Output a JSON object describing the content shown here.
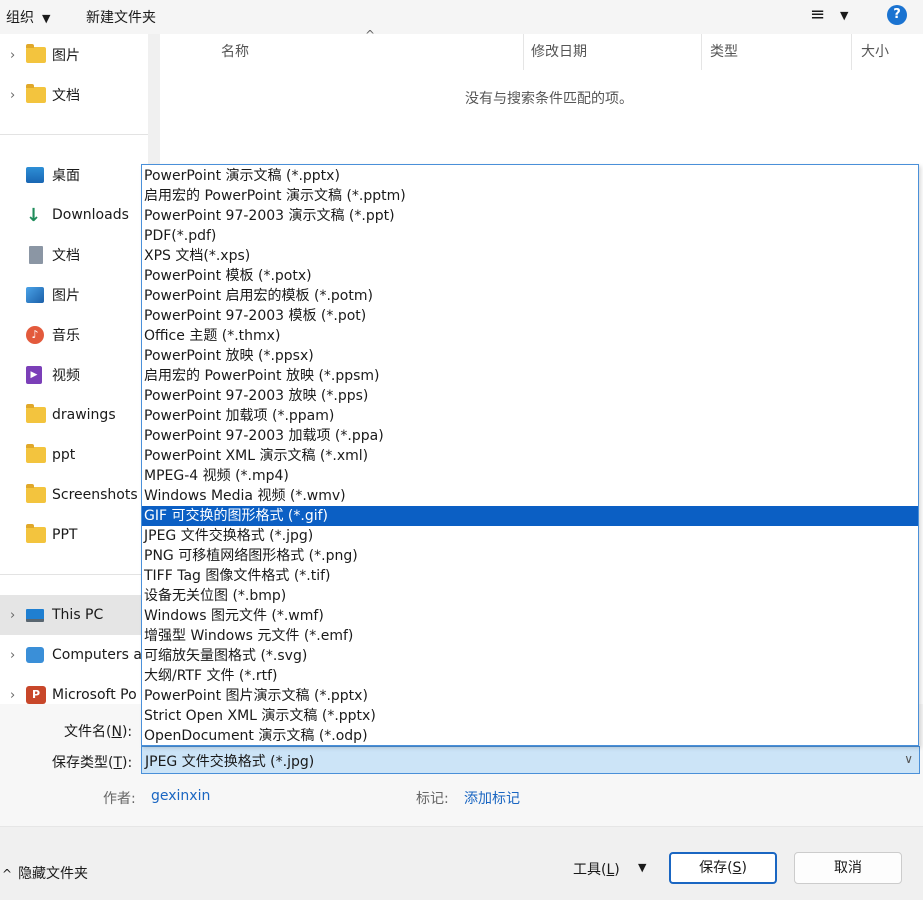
{
  "toolbar": {
    "organize": "组织",
    "new_folder": "新建文件夹",
    "view_icon": "≡",
    "help": "?"
  },
  "nav": {
    "items": [
      {
        "label": "图片",
        "icon": "folder-icon",
        "chevron": true
      },
      {
        "label": "文档",
        "icon": "folder-icon",
        "chevron": true
      },
      {
        "label": "桌面",
        "icon": "desktop-icon",
        "chevron": false
      },
      {
        "label": "Downloads",
        "icon": "download-icon",
        "chevron": false
      },
      {
        "label": "文档",
        "icon": "document-icon",
        "chevron": false
      },
      {
        "label": "图片",
        "icon": "pictures-icon",
        "chevron": false
      },
      {
        "label": "音乐",
        "icon": "music-icon",
        "chevron": false
      },
      {
        "label": "视频",
        "icon": "video-icon",
        "chevron": false
      },
      {
        "label": "drawings",
        "icon": "folder-icon",
        "chevron": false
      },
      {
        "label": "ppt",
        "icon": "folder-icon",
        "chevron": false
      },
      {
        "label": "Screenshots",
        "icon": "folder-icon",
        "chevron": false
      },
      {
        "label": "PPT",
        "icon": "folder-icon",
        "chevron": false
      },
      {
        "label": "This PC",
        "icon": "pc-icon",
        "chevron": true
      },
      {
        "label": "Computers a",
        "icon": "network-icon",
        "chevron": true
      },
      {
        "label": "Microsoft Po",
        "icon": "powerpoint-icon",
        "chevron": true
      }
    ]
  },
  "list": {
    "columns": [
      "名称",
      "修改日期",
      "类型",
      "大小"
    ],
    "empty_message": "没有与搜索条件匹配的项。"
  },
  "dropdown": {
    "options": [
      "PowerPoint 演示文稿 (*.pptx)",
      "启用宏的 PowerPoint 演示文稿 (*.pptm)",
      "PowerPoint 97-2003 演示文稿 (*.ppt)",
      "PDF(*.pdf)",
      "XPS 文档(*.xps)",
      "PowerPoint 模板 (*.potx)",
      "PowerPoint 启用宏的模板 (*.potm)",
      "PowerPoint 97-2003 模板 (*.pot)",
      "Office 主题 (*.thmx)",
      "PowerPoint 放映 (*.ppsx)",
      "启用宏的 PowerPoint 放映 (*.ppsm)",
      "PowerPoint 97-2003 放映 (*.pps)",
      "PowerPoint 加载项 (*.ppam)",
      "PowerPoint 97-2003 加载项 (*.ppa)",
      "PowerPoint XML 演示文稿 (*.xml)",
      "MPEG-4 视频 (*.mp4)",
      "Windows Media 视频 (*.wmv)",
      "GIF 可交换的图形格式 (*.gif)",
      "JPEG 文件交换格式 (*.jpg)",
      "PNG 可移植网络图形格式 (*.png)",
      "TIFF Tag 图像文件格式 (*.tif)",
      "设备无关位图 (*.bmp)",
      "Windows 图元文件 (*.wmf)",
      "增强型 Windows 元文件 (*.emf)",
      "可缩放矢量图格式 (*.svg)",
      "大纲/RTF 文件 (*.rtf)",
      "PowerPoint 图片演示文稿 (*.pptx)",
      "Strict Open XML 演示文稿 (*.pptx)",
      "OpenDocument 演示文稿 (*.odp)"
    ],
    "highlighted": "GIF 可交换的图形格式 (*.gif)",
    "highlight_color": "#0b5fc4"
  },
  "form": {
    "filename_label": "文件名(",
    "filename_key": "N",
    "filename_label_end": "):",
    "filetype_label": "保存类型(",
    "filetype_key": "T",
    "filetype_label_end": "):",
    "filetype_value": "JPEG 文件交换格式 (*.jpg)",
    "author_label": "作者:",
    "author_value": "gexinxin",
    "tags_label": "标记:",
    "tags_value": "添加标记"
  },
  "bottom": {
    "hide_folders": "隐藏文件夹",
    "tools_label": "工具(",
    "tools_key": "L",
    "tools_label_end": ")",
    "save_label": "保存(",
    "save_key": "S",
    "save_label_end": ")",
    "cancel": "取消"
  }
}
